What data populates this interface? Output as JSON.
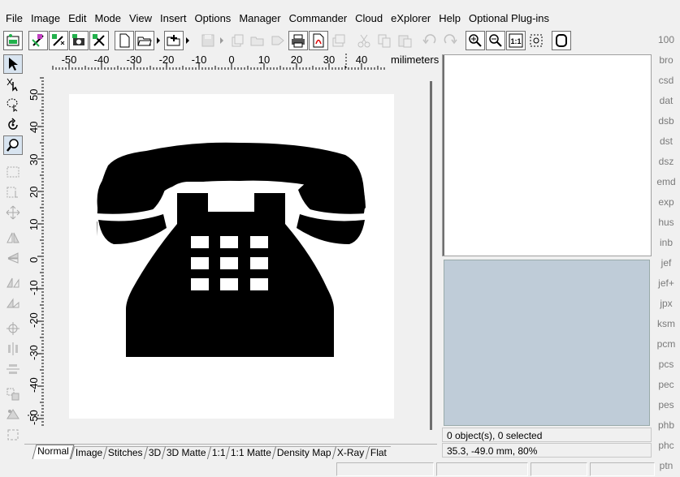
{
  "menu": [
    "File",
    "Image",
    "Edit",
    "Mode",
    "View",
    "Insert",
    "Options",
    "Manager",
    "Commander",
    "Cloud",
    "eXplorer",
    "Help",
    "Optional Plug-ins"
  ],
  "ruler": {
    "h_labels": [
      "-50",
      "-40",
      "-30",
      "-20",
      "-10",
      "0",
      "10",
      "20",
      "30",
      "40"
    ],
    "unit": "milimeters",
    "v_labels": [
      "50",
      "40",
      "30",
      "20",
      "10",
      "0",
      "-10",
      "-20",
      "-30",
      "-40",
      "-50"
    ]
  },
  "tabs": [
    "Normal",
    "Image",
    "Stitches",
    "3D",
    "3D Matte",
    "1:1",
    "1:1 Matte",
    "Density Map",
    "X-Ray",
    "Flat"
  ],
  "active_tab": "Normal",
  "status": {
    "selection": "0 object(s), 0 selected",
    "coords": "35.3, -49.0 mm, 80%"
  },
  "formats": [
    "100",
    "bro",
    "csd",
    "dat",
    "dsb",
    "dst",
    "dsz",
    "emd",
    "exp",
    "hus",
    "inb",
    "jef",
    "jef+",
    "jpx",
    "ksm",
    "pcm",
    "pcs",
    "pec",
    "pes",
    "phb",
    "phc",
    "ptn"
  ],
  "colors": {
    "preview_bg": "#bfccd8",
    "accent_green": "#22b14c",
    "accent_magenta": "#c040c0"
  },
  "icons": {
    "toolbar": [
      "design-list-icon",
      "edit-stitch-icon",
      "magic-wand-icon",
      "camera-icon",
      "remove-stitch-icon",
      "new-file-icon",
      "open-folder-icon",
      "add-item-icon",
      "save-icon",
      "export-icon",
      "folder-icon",
      "send-icon",
      "print-icon",
      "pdf-icon",
      "card-icon",
      "cut-icon",
      "copy-icon",
      "paste-icon",
      "undo-icon",
      "redo-icon",
      "zoom-in-icon",
      "zoom-out-icon",
      "zoom-actual-icon",
      "zoom-fit-icon",
      "hoop-icon"
    ],
    "left": [
      "select-arrow-icon",
      "lasso-select-icon",
      "freehand-select-icon",
      "rotate-icon",
      "zoom-tool-icon",
      "rect-select-icon",
      "resize-icon",
      "move-icon",
      "flip-h-icon",
      "flip-v-icon",
      "skew-h-icon",
      "skew-v-icon",
      "center-icon",
      "align-h-icon",
      "align-v-icon",
      "group-icon",
      "ungroup-icon",
      "crop-icon"
    ]
  }
}
